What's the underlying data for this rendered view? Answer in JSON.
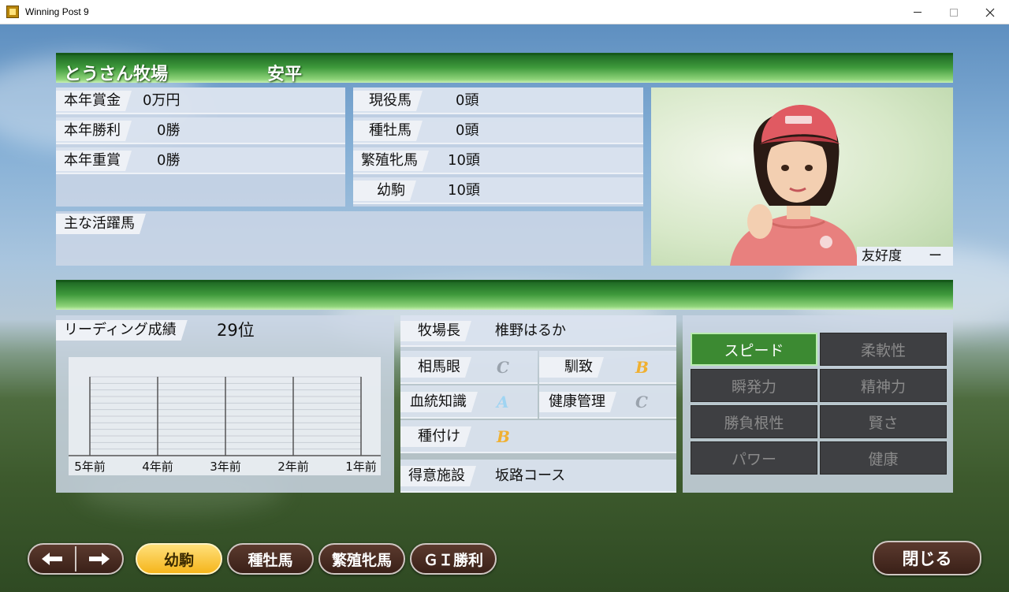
{
  "window": {
    "title": "Winning Post 9"
  },
  "farm": {
    "name": "とうさん牧場",
    "owner": "安平"
  },
  "stats_left": [
    {
      "label": "本年賞金",
      "value": "0万円"
    },
    {
      "label": "本年勝利",
      "value": "0勝"
    },
    {
      "label": "本年重賞",
      "value": "0勝"
    }
  ],
  "stats_right": [
    {
      "label": "現役馬",
      "value": "0頭"
    },
    {
      "label": "種牡馬",
      "value": "0頭"
    },
    {
      "label": "繁殖牝馬",
      "value": "10頭"
    },
    {
      "label": "幼駒",
      "value": "10頭"
    }
  ],
  "main_horses": {
    "label": "主な活躍馬"
  },
  "friendship": {
    "label": "友好度",
    "value": "ー"
  },
  "leading": {
    "label": "リーディング成績",
    "value": "29位"
  },
  "chart_data": {
    "type": "line",
    "categories": [
      "5年前",
      "4年前",
      "3年前",
      "2年前",
      "1年前"
    ],
    "series": [],
    "grid": true
  },
  "manager": {
    "label": "牧場長",
    "value": "椎野はるか"
  },
  "abilities": [
    {
      "label": "相馬眼",
      "grade": "C",
      "color": "#9aa3ad"
    },
    {
      "label": "馴致",
      "grade": "B",
      "color": "#f0b030"
    },
    {
      "label": "血統知識",
      "grade": "A",
      "color": "#9fd4f2"
    },
    {
      "label": "健康管理",
      "grade": "C",
      "color": "#9aa3ad"
    },
    {
      "label": "種付け",
      "grade": "B",
      "color": "#f0b030"
    }
  ],
  "specialty": {
    "label": "得意施設",
    "value": "坂路コース"
  },
  "skills": [
    {
      "label": "スピード",
      "active": true
    },
    {
      "label": "柔軟性",
      "active": false
    },
    {
      "label": "瞬発力",
      "active": false
    },
    {
      "label": "精神力",
      "active": false
    },
    {
      "label": "勝負根性",
      "active": false
    },
    {
      "label": "賢さ",
      "active": false
    },
    {
      "label": "パワー",
      "active": false
    },
    {
      "label": "健康",
      "active": false
    }
  ],
  "nav": {
    "prev": "🡐",
    "next": "🡒",
    "tabs": [
      "幼駒",
      "種牡馬",
      "繁殖牝馬",
      "ＧＩ勝利"
    ],
    "active_tab": "幼駒",
    "close": "閉じる"
  }
}
